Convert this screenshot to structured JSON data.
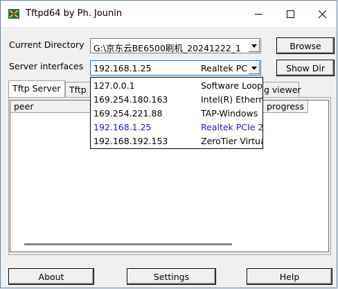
{
  "window": {
    "title": "Tftpd64 by Ph. Jounin",
    "minimize_icon": "minimize-icon",
    "maximize_icon": "maximize-icon",
    "close_icon": "close-icon"
  },
  "current_directory": {
    "label": "Current Directory",
    "value": "G:\\京东云BE6500刷机_20241222_1"
  },
  "server_interfaces": {
    "label": "Server interfaces",
    "selected_ip": "192.168.1.25",
    "selected_nic": "Realtek PC"
  },
  "buttons": {
    "browse": "Browse",
    "show_dir": "Show Dir",
    "about": "About",
    "settings": "Settings",
    "help": "Help"
  },
  "tabs": {
    "tftp_server": "Tftp Server",
    "tftp_client_partial": "Tftp",
    "log_viewer_partial": "g viewer"
  },
  "table": {
    "col_peer": "peer",
    "col_progress_partial": "progress"
  },
  "interface_options": [
    {
      "ip": "127.0.0.1",
      "nic": "Software Loopb"
    },
    {
      "ip": "169.254.180.163",
      "nic": "Intel(R) Etherne"
    },
    {
      "ip": "169.254.221.88",
      "nic": "TAP-Windows"
    },
    {
      "ip": "192.168.1.25",
      "nic": "Realtek PCIe 2"
    },
    {
      "ip": "192.168.192.153",
      "nic": "ZeroTier Virtua"
    }
  ],
  "colors": {
    "selected_option": "#1a1ad0",
    "window_border": "#5b86b9"
  }
}
